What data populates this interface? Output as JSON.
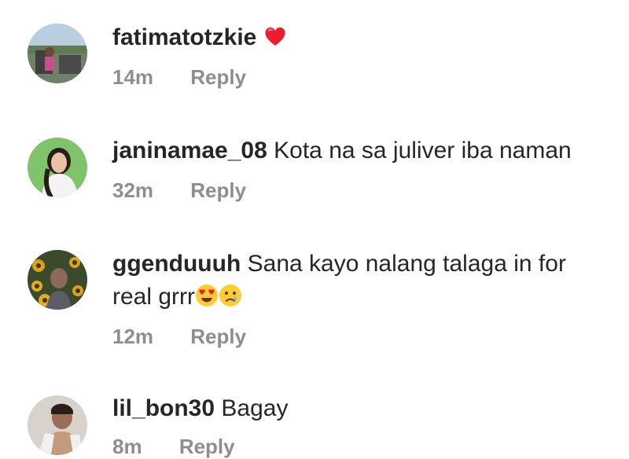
{
  "comments": [
    {
      "username": "fatimatotzkie",
      "text": "",
      "emojis": [
        "red-heart"
      ],
      "time": "14m",
      "reply_label": "Reply"
    },
    {
      "username": "janinamae_08",
      "text": "Kota na sa juliver iba naman",
      "emojis": [],
      "time": "32m",
      "reply_label": "Reply"
    },
    {
      "username": "ggenduuuh",
      "text_line1": "Sana kayo nalang talaga in for",
      "text_line2": "real grrr",
      "emojis": [
        "heart-eyes-face",
        "crying-face"
      ],
      "time": "12m",
      "reply_label": "Reply"
    },
    {
      "username": "lil_bon30",
      "text": "Bagay",
      "emojis": [],
      "time": "8m",
      "reply_label": "Reply"
    }
  ],
  "colors": {
    "text": "#262626",
    "meta": "#8e8e8e",
    "heart": "#ed1c2e"
  }
}
